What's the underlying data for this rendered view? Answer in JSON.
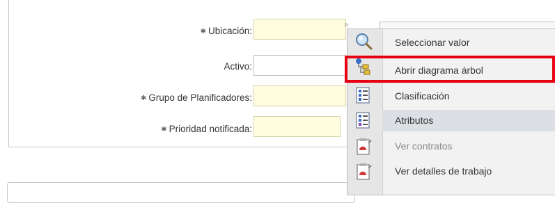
{
  "form": {
    "fields": [
      {
        "label": "Ubicación:",
        "required": true,
        "value": ""
      },
      {
        "label": "Activo:",
        "required": false,
        "value": ""
      },
      {
        "label": "Grupo de Planificadores:",
        "required": true,
        "value": ""
      },
      {
        "label": "Prioridad notificada:",
        "required": true,
        "value": ""
      }
    ],
    "required_marker": "✱"
  },
  "menu": {
    "items": [
      {
        "label": "Seleccionar valor",
        "icon": "magnifier-icon",
        "state": "normal"
      },
      {
        "label": "Abrir diagrama árbol",
        "icon": "tree-diagram-icon",
        "state": "highlighted"
      },
      {
        "label": "Clasificación",
        "icon": "classification-icon",
        "state": "normal"
      },
      {
        "label": "Atributos",
        "icon": "attributes-icon",
        "state": "active"
      },
      {
        "label": "Ver contratos",
        "icon": "contracts-icon",
        "state": "disabled"
      },
      {
        "label": "Ver detalles de trabajo",
        "icon": "work-details-icon",
        "state": "normal"
      }
    ]
  },
  "colors": {
    "required_field_bg": "#fffde0",
    "highlight_border": "#e60012",
    "menu_bg": "#f2f2f2",
    "menu_active_bg": "#dcdfe4"
  }
}
